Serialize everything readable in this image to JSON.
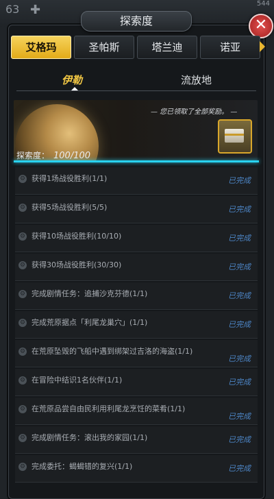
{
  "background": {
    "left_number": "63",
    "right_text": "544"
  },
  "dialog": {
    "title": "探索度",
    "close_label": "✕"
  },
  "planet_tabs": [
    {
      "label": "艾格玛",
      "active": true
    },
    {
      "label": "圣帕斯",
      "active": false
    },
    {
      "label": "塔兰迪",
      "active": false
    },
    {
      "label": "诺亚",
      "active": false
    }
  ],
  "sub_tabs": [
    {
      "label": "伊勒",
      "active": true
    },
    {
      "label": "流放地",
      "active": false
    }
  ],
  "banner": {
    "message": "— 您已领取了全部奖励。 —",
    "progress_label": "探索度：",
    "progress_value": "100/100",
    "progress_fraction": 1.0
  },
  "tasks": [
    {
      "text": "获得1场战役胜利(1/1)",
      "status": "已完成"
    },
    {
      "text": "获得5场战役胜利(5/5)",
      "status": "已完成"
    },
    {
      "text": "获得10场战役胜利(10/10)",
      "status": "已完成"
    },
    {
      "text": "获得30场战役胜利(30/30)",
      "status": "已完成"
    },
    {
      "text": "完成剧情任务：追捕沙克芬德(1/1)",
      "status": "已完成"
    },
    {
      "text": "完成荒原据点「利尾龙巢穴」(1/1)",
      "status": "已完成"
    },
    {
      "text": "在荒原坠毁的飞船中遇到绑架过吉洛的海盗(1/1)",
      "status": "已完成"
    },
    {
      "text": "在冒险中结识1名伙伴(1/1)",
      "status": "已完成"
    },
    {
      "text": "在荒原品尝自由民利用利尾龙烹饪的菜肴(1/1)",
      "status": "已完成"
    },
    {
      "text": "完成剧情任务：滚出我的家园(1/1)",
      "status": "已完成"
    },
    {
      "text": "完成委托：蝎蝎错的复兴(1/1)",
      "status": "已完成"
    }
  ]
}
